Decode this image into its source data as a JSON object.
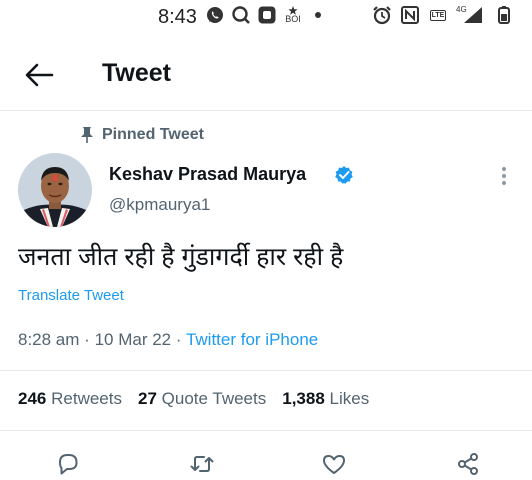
{
  "status_bar": {
    "time": "8:43",
    "boi_label": "BOI",
    "lte_label": "LTE",
    "network": "4G"
  },
  "header": {
    "title": "Tweet"
  },
  "tweet": {
    "pinned_label": "Pinned Tweet",
    "author_name": "Keshav Prasad Maurya",
    "author_handle": "@kpmaurya1",
    "text": "जनता जीत रही है गुंडागर्दी हार रही है",
    "translate_label": "Translate Tweet",
    "time": "8:28 am",
    "separator": "·",
    "date": "10 Mar 22",
    "source": "Twitter for iPhone"
  },
  "stats": {
    "retweets_count": "246",
    "retweets_label": "Retweets",
    "quote_count": "27",
    "quote_label": "Quote Tweets",
    "likes_count": "1,388",
    "likes_label": "Likes"
  },
  "colors": {
    "accent": "#1d9bf0",
    "secondary_text": "#536471",
    "primary_text": "#0f1419",
    "divider": "#e4e9ec"
  },
  "icons": [
    "whatsapp-icon",
    "search-icon",
    "app-icon",
    "boi-icon",
    "alarm-icon",
    "nfc-icon",
    "volte-icon",
    "signal-icon",
    "battery-icon",
    "back-arrow-icon",
    "pin-icon",
    "verified-icon",
    "more-icon",
    "reply-icon",
    "retweet-icon",
    "like-icon",
    "share-icon"
  ]
}
